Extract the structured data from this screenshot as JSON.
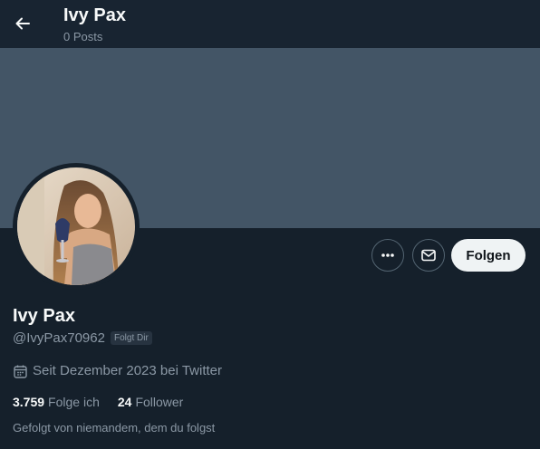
{
  "header": {
    "title": "Ivy Pax",
    "posts": "0 Posts"
  },
  "profile": {
    "name": "Ivy Pax",
    "handle": "@IvyPax70962",
    "follows_you_badge": "Folgt Dir",
    "joined": "Seit Dezember 2023 bei Twitter",
    "following_count": "3.759",
    "following_label": "Folge ich",
    "followers_count": "24",
    "followers_label": "Follower",
    "followed_by": "Gefolgt von niemandem, dem du folgst"
  },
  "actions": {
    "follow_label": "Folgen"
  },
  "colors": {
    "background": "#15202b",
    "banner": "#435566",
    "follow_button": "#eff3f4",
    "secondary_text": "#8b98a5"
  },
  "icons": {
    "back": "arrow-left-icon",
    "more": "more-horizontal-icon",
    "message": "envelope-icon",
    "calendar": "calendar-icon"
  }
}
